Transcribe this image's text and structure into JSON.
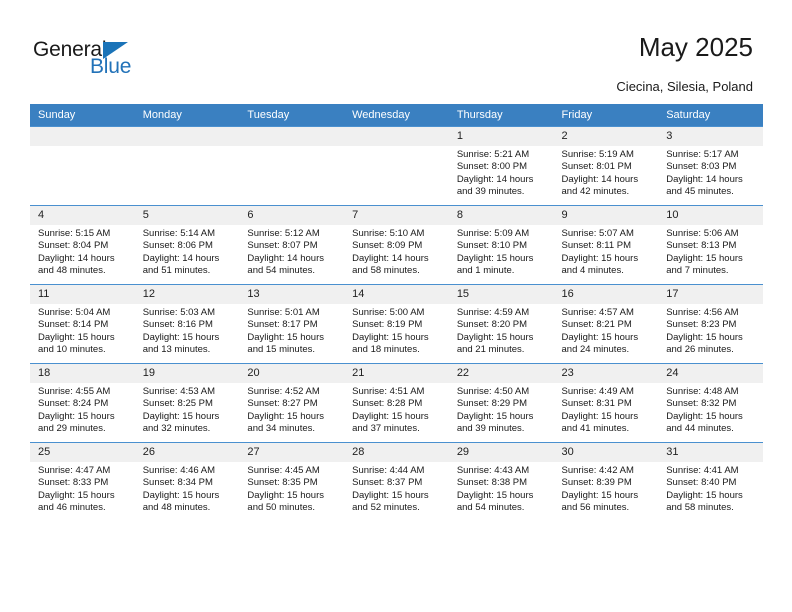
{
  "brand": {
    "name_top": "General",
    "name_bottom": "Blue",
    "accent_color": "#2272b8",
    "triangle_color": "#1a73b8"
  },
  "header": {
    "title": "May 2025",
    "subtitle": "Ciecina, Silesia, Poland"
  },
  "calendar": {
    "header_bg": "#3a80c1",
    "daynum_bg": "#f0f0f0",
    "weekdays": [
      "Sunday",
      "Monday",
      "Tuesday",
      "Wednesday",
      "Thursday",
      "Friday",
      "Saturday"
    ],
    "weeks": [
      [
        {
          "empty": true
        },
        {
          "empty": true
        },
        {
          "empty": true
        },
        {
          "empty": true
        },
        {
          "day": "1",
          "sunrise": "Sunrise: 5:21 AM",
          "sunset": "Sunset: 8:00 PM",
          "daylight1": "Daylight: 14 hours",
          "daylight2": "and 39 minutes."
        },
        {
          "day": "2",
          "sunrise": "Sunrise: 5:19 AM",
          "sunset": "Sunset: 8:01 PM",
          "daylight1": "Daylight: 14 hours",
          "daylight2": "and 42 minutes."
        },
        {
          "day": "3",
          "sunrise": "Sunrise: 5:17 AM",
          "sunset": "Sunset: 8:03 PM",
          "daylight1": "Daylight: 14 hours",
          "daylight2": "and 45 minutes."
        }
      ],
      [
        {
          "day": "4",
          "sunrise": "Sunrise: 5:15 AM",
          "sunset": "Sunset: 8:04 PM",
          "daylight1": "Daylight: 14 hours",
          "daylight2": "and 48 minutes."
        },
        {
          "day": "5",
          "sunrise": "Sunrise: 5:14 AM",
          "sunset": "Sunset: 8:06 PM",
          "daylight1": "Daylight: 14 hours",
          "daylight2": "and 51 minutes."
        },
        {
          "day": "6",
          "sunrise": "Sunrise: 5:12 AM",
          "sunset": "Sunset: 8:07 PM",
          "daylight1": "Daylight: 14 hours",
          "daylight2": "and 54 minutes."
        },
        {
          "day": "7",
          "sunrise": "Sunrise: 5:10 AM",
          "sunset": "Sunset: 8:09 PM",
          "daylight1": "Daylight: 14 hours",
          "daylight2": "and 58 minutes."
        },
        {
          "day": "8",
          "sunrise": "Sunrise: 5:09 AM",
          "sunset": "Sunset: 8:10 PM",
          "daylight1": "Daylight: 15 hours",
          "daylight2": "and 1 minute."
        },
        {
          "day": "9",
          "sunrise": "Sunrise: 5:07 AM",
          "sunset": "Sunset: 8:11 PM",
          "daylight1": "Daylight: 15 hours",
          "daylight2": "and 4 minutes."
        },
        {
          "day": "10",
          "sunrise": "Sunrise: 5:06 AM",
          "sunset": "Sunset: 8:13 PM",
          "daylight1": "Daylight: 15 hours",
          "daylight2": "and 7 minutes."
        }
      ],
      [
        {
          "day": "11",
          "sunrise": "Sunrise: 5:04 AM",
          "sunset": "Sunset: 8:14 PM",
          "daylight1": "Daylight: 15 hours",
          "daylight2": "and 10 minutes."
        },
        {
          "day": "12",
          "sunrise": "Sunrise: 5:03 AM",
          "sunset": "Sunset: 8:16 PM",
          "daylight1": "Daylight: 15 hours",
          "daylight2": "and 13 minutes."
        },
        {
          "day": "13",
          "sunrise": "Sunrise: 5:01 AM",
          "sunset": "Sunset: 8:17 PM",
          "daylight1": "Daylight: 15 hours",
          "daylight2": "and 15 minutes."
        },
        {
          "day": "14",
          "sunrise": "Sunrise: 5:00 AM",
          "sunset": "Sunset: 8:19 PM",
          "daylight1": "Daylight: 15 hours",
          "daylight2": "and 18 minutes."
        },
        {
          "day": "15",
          "sunrise": "Sunrise: 4:59 AM",
          "sunset": "Sunset: 8:20 PM",
          "daylight1": "Daylight: 15 hours",
          "daylight2": "and 21 minutes."
        },
        {
          "day": "16",
          "sunrise": "Sunrise: 4:57 AM",
          "sunset": "Sunset: 8:21 PM",
          "daylight1": "Daylight: 15 hours",
          "daylight2": "and 24 minutes."
        },
        {
          "day": "17",
          "sunrise": "Sunrise: 4:56 AM",
          "sunset": "Sunset: 8:23 PM",
          "daylight1": "Daylight: 15 hours",
          "daylight2": "and 26 minutes."
        }
      ],
      [
        {
          "day": "18",
          "sunrise": "Sunrise: 4:55 AM",
          "sunset": "Sunset: 8:24 PM",
          "daylight1": "Daylight: 15 hours",
          "daylight2": "and 29 minutes."
        },
        {
          "day": "19",
          "sunrise": "Sunrise: 4:53 AM",
          "sunset": "Sunset: 8:25 PM",
          "daylight1": "Daylight: 15 hours",
          "daylight2": "and 32 minutes."
        },
        {
          "day": "20",
          "sunrise": "Sunrise: 4:52 AM",
          "sunset": "Sunset: 8:27 PM",
          "daylight1": "Daylight: 15 hours",
          "daylight2": "and 34 minutes."
        },
        {
          "day": "21",
          "sunrise": "Sunrise: 4:51 AM",
          "sunset": "Sunset: 8:28 PM",
          "daylight1": "Daylight: 15 hours",
          "daylight2": "and 37 minutes."
        },
        {
          "day": "22",
          "sunrise": "Sunrise: 4:50 AM",
          "sunset": "Sunset: 8:29 PM",
          "daylight1": "Daylight: 15 hours",
          "daylight2": "and 39 minutes."
        },
        {
          "day": "23",
          "sunrise": "Sunrise: 4:49 AM",
          "sunset": "Sunset: 8:31 PM",
          "daylight1": "Daylight: 15 hours",
          "daylight2": "and 41 minutes."
        },
        {
          "day": "24",
          "sunrise": "Sunrise: 4:48 AM",
          "sunset": "Sunset: 8:32 PM",
          "daylight1": "Daylight: 15 hours",
          "daylight2": "and 44 minutes."
        }
      ],
      [
        {
          "day": "25",
          "sunrise": "Sunrise: 4:47 AM",
          "sunset": "Sunset: 8:33 PM",
          "daylight1": "Daylight: 15 hours",
          "daylight2": "and 46 minutes."
        },
        {
          "day": "26",
          "sunrise": "Sunrise: 4:46 AM",
          "sunset": "Sunset: 8:34 PM",
          "daylight1": "Daylight: 15 hours",
          "daylight2": "and 48 minutes."
        },
        {
          "day": "27",
          "sunrise": "Sunrise: 4:45 AM",
          "sunset": "Sunset: 8:35 PM",
          "daylight1": "Daylight: 15 hours",
          "daylight2": "and 50 minutes."
        },
        {
          "day": "28",
          "sunrise": "Sunrise: 4:44 AM",
          "sunset": "Sunset: 8:37 PM",
          "daylight1": "Daylight: 15 hours",
          "daylight2": "and 52 minutes."
        },
        {
          "day": "29",
          "sunrise": "Sunrise: 4:43 AM",
          "sunset": "Sunset: 8:38 PM",
          "daylight1": "Daylight: 15 hours",
          "daylight2": "and 54 minutes."
        },
        {
          "day": "30",
          "sunrise": "Sunrise: 4:42 AM",
          "sunset": "Sunset: 8:39 PM",
          "daylight1": "Daylight: 15 hours",
          "daylight2": "and 56 minutes."
        },
        {
          "day": "31",
          "sunrise": "Sunrise: 4:41 AM",
          "sunset": "Sunset: 8:40 PM",
          "daylight1": "Daylight: 15 hours",
          "daylight2": "and 58 minutes."
        }
      ]
    ]
  }
}
